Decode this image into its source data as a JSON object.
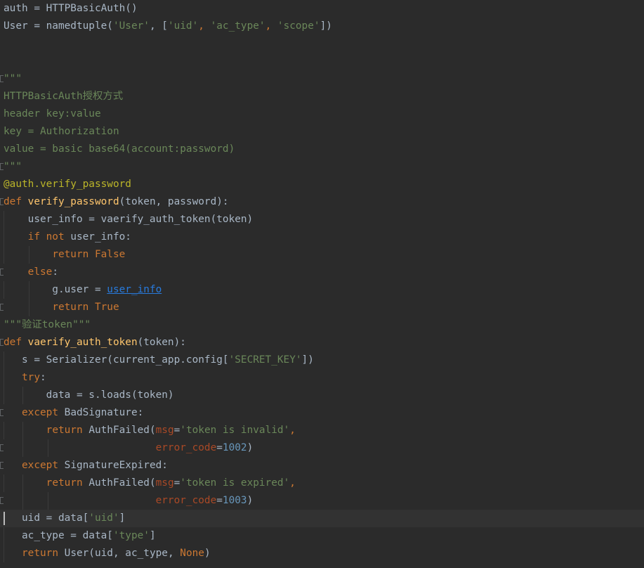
{
  "editor": {
    "lines": [
      {
        "tokens": [
          {
            "t": "auth = HTTPBasicAuth()",
            "c": "plain"
          }
        ]
      },
      {
        "tokens": [
          {
            "t": "User = namedtuple(",
            "c": "plain"
          },
          {
            "t": "'User'",
            "c": "string"
          },
          {
            "t": ", [",
            "c": "plain"
          },
          {
            "t": "'uid'",
            "c": "string"
          },
          {
            "t": ", ",
            "c": "keyword"
          },
          {
            "t": "'ac_type'",
            "c": "string"
          },
          {
            "t": ", ",
            "c": "keyword"
          },
          {
            "t": "'scope'",
            "c": "string"
          },
          {
            "t": "])",
            "c": "plain"
          }
        ]
      },
      {
        "tokens": []
      },
      {
        "tokens": []
      },
      {
        "fold": true,
        "tokens": [
          {
            "t": "\"\"\"",
            "c": "string"
          }
        ]
      },
      {
        "tokens": [
          {
            "t": "HTTPBasicAuth授权方式",
            "c": "string"
          }
        ]
      },
      {
        "tokens": [
          {
            "t": "header key:value",
            "c": "string"
          }
        ]
      },
      {
        "tokens": [
          {
            "t": "key = Authorization",
            "c": "string"
          }
        ]
      },
      {
        "tokens": [
          {
            "t": "value = basic base64(account:password)",
            "c": "string"
          }
        ]
      },
      {
        "fold": true,
        "tokens": [
          {
            "t": "\"\"\"",
            "c": "string"
          }
        ]
      },
      {
        "tokens": [
          {
            "t": "@auth.verify_password",
            "c": "decorator"
          }
        ]
      },
      {
        "fold": true,
        "tokens": [
          {
            "t": "def ",
            "c": "keyword"
          },
          {
            "t": "verify_password",
            "c": "func"
          },
          {
            "t": "(token, password):",
            "c": "plain"
          }
        ]
      },
      {
        "guides": [
          5
        ],
        "tokens": [
          {
            "t": "    user_info = vaerify_auth_token(token)",
            "c": "plain"
          }
        ]
      },
      {
        "guides": [
          5
        ],
        "tokens": [
          {
            "t": "    ",
            "c": "plain"
          },
          {
            "t": "if not ",
            "c": "keyword"
          },
          {
            "t": "user_info:",
            "c": "plain"
          }
        ]
      },
      {
        "guides": [
          5,
          41
        ],
        "tokens": [
          {
            "t": "        ",
            "c": "plain"
          },
          {
            "t": "return False",
            "c": "keyword"
          }
        ]
      },
      {
        "fold": true,
        "tokens": [
          {
            "t": "    ",
            "c": "plain"
          },
          {
            "t": "else",
            "c": "keyword"
          },
          {
            "t": ":",
            "c": "plain"
          }
        ]
      },
      {
        "guides": [
          5,
          41
        ],
        "tokens": [
          {
            "t": "        g.user = ",
            "c": "plain"
          },
          {
            "t": "user_info",
            "c": "link"
          }
        ]
      },
      {
        "fold": true,
        "guides": [
          41
        ],
        "tokens": [
          {
            "t": "        ",
            "c": "plain"
          },
          {
            "t": "return True",
            "c": "keyword"
          }
        ]
      },
      {
        "tokens": [
          {
            "t": "\"\"\"验证token\"\"\"",
            "c": "string"
          }
        ]
      },
      {
        "fold": true,
        "tokens": [
          {
            "t": "def ",
            "c": "keyword"
          },
          {
            "t": "vaerify_auth_token",
            "c": "func"
          },
          {
            "t": "(token):",
            "c": "plain"
          }
        ]
      },
      {
        "guides": [
          5
        ],
        "tokens": [
          {
            "t": "   s = Serializer(current_app.config[",
            "c": "plain"
          },
          {
            "t": "'SECRET_KEY'",
            "c": "string"
          },
          {
            "t": "])",
            "c": "plain"
          }
        ]
      },
      {
        "guides": [
          5
        ],
        "tokens": [
          {
            "t": "   ",
            "c": "plain"
          },
          {
            "t": "try",
            "c": "keyword"
          },
          {
            "t": ":",
            "c": "plain"
          }
        ]
      },
      {
        "guides": [
          5,
          32
        ],
        "tokens": [
          {
            "t": "       data = s.loads(token)",
            "c": "plain"
          }
        ]
      },
      {
        "fold": true,
        "tokens": [
          {
            "t": "   ",
            "c": "plain"
          },
          {
            "t": "except ",
            "c": "keyword"
          },
          {
            "t": "BadSignature:",
            "c": "plain"
          }
        ]
      },
      {
        "guides": [
          5,
          32
        ],
        "tokens": [
          {
            "t": "       ",
            "c": "plain"
          },
          {
            "t": "return ",
            "c": "keyword"
          },
          {
            "t": "AuthFailed(",
            "c": "plain"
          },
          {
            "t": "msg",
            "c": "param"
          },
          {
            "t": "=",
            "c": "plain"
          },
          {
            "t": "'token is invalid'",
            "c": "string"
          },
          {
            "t": ",",
            "c": "keyword"
          }
        ]
      },
      {
        "fold": true,
        "guides": [
          32,
          68
        ],
        "tokens": [
          {
            "t": "                         ",
            "c": "plain"
          },
          {
            "t": "error_code",
            "c": "param"
          },
          {
            "t": "=",
            "c": "plain"
          },
          {
            "t": "1002",
            "c": "number"
          },
          {
            "t": ")",
            "c": "plain"
          }
        ]
      },
      {
        "fold": true,
        "tokens": [
          {
            "t": "   ",
            "c": "plain"
          },
          {
            "t": "except ",
            "c": "keyword"
          },
          {
            "t": "SignatureExpired:",
            "c": "plain"
          }
        ]
      },
      {
        "guides": [
          5,
          32
        ],
        "tokens": [
          {
            "t": "       ",
            "c": "plain"
          },
          {
            "t": "return ",
            "c": "keyword"
          },
          {
            "t": "AuthFailed(",
            "c": "plain"
          },
          {
            "t": "msg",
            "c": "param"
          },
          {
            "t": "=",
            "c": "plain"
          },
          {
            "t": "'token is expired'",
            "c": "string"
          },
          {
            "t": ",",
            "c": "keyword"
          }
        ]
      },
      {
        "fold": true,
        "guides": [
          32,
          68
        ],
        "tokens": [
          {
            "t": "                         ",
            "c": "plain"
          },
          {
            "t": "error_code",
            "c": "param"
          },
          {
            "t": "=",
            "c": "plain"
          },
          {
            "t": "1003",
            "c": "number"
          },
          {
            "t": ")",
            "c": "plain"
          }
        ]
      },
      {
        "current": true,
        "tokens": [
          {
            "t": "   uid = data[",
            "c": "plain"
          },
          {
            "t": "'uid'",
            "c": "string"
          },
          {
            "t": "]",
            "c": "plain"
          }
        ]
      },
      {
        "guides": [
          5
        ],
        "tokens": [
          {
            "t": "   ac_type = data[",
            "c": "plain"
          },
          {
            "t": "'type'",
            "c": "string"
          },
          {
            "t": "]",
            "c": "plain"
          }
        ]
      },
      {
        "guides": [
          5
        ],
        "tokens": [
          {
            "t": "   ",
            "c": "plain"
          },
          {
            "t": "return ",
            "c": "keyword"
          },
          {
            "t": "User(uid, ac_type, ",
            "c": "plain"
          },
          {
            "t": "None",
            "c": "keyword"
          },
          {
            "t": ")",
            "c": "plain"
          }
        ]
      }
    ]
  }
}
